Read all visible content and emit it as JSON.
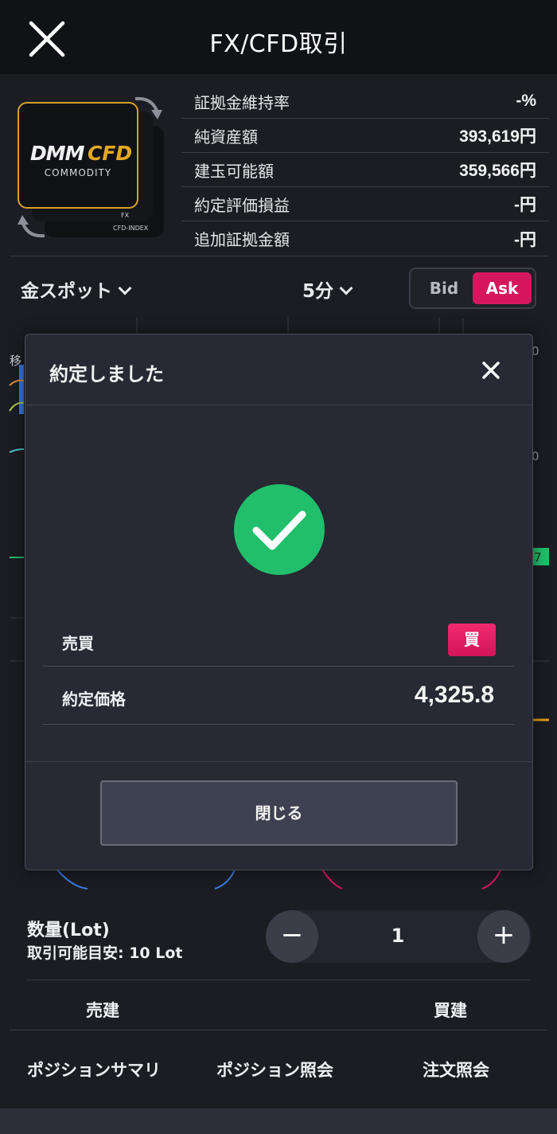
{
  "header": {
    "title": "FX/CFD取引"
  },
  "logo": {
    "brand_left": "DMM",
    "brand_right": "CFD",
    "subtitle": "COMMODITY",
    "tag_fx": "FX",
    "tag_index": "CFD-INDEX"
  },
  "account": {
    "rows": [
      {
        "label": "証拠金維持率",
        "value": "-%"
      },
      {
        "label": "純資産額",
        "value": "393,619円"
      },
      {
        "label": "建玉可能額",
        "value": "359,566円"
      },
      {
        "label": "約定評価損益",
        "value": "-円"
      },
      {
        "label": "追加証拠金額",
        "value": "-円"
      }
    ]
  },
  "toolbar": {
    "instrument": "金スポット",
    "timeframe": "5分",
    "bid_label": "Bid",
    "ask_label": "Ask"
  },
  "chart": {
    "partial_label": "移",
    "tick_1": "0",
    "tick_2": "0",
    "tick_3": "7"
  },
  "modal": {
    "title": "約定しました",
    "side_label": "売買",
    "side_value": "買",
    "price_label": "約定価格",
    "price_value": "4,325.8",
    "close_label": "閉じる"
  },
  "quantity": {
    "title": "数量(Lot)",
    "hint": "取引可能目安: 10 Lot",
    "value": "1",
    "minus": "−",
    "plus": "+"
  },
  "actions": {
    "sell": "売建",
    "buy": "買建"
  },
  "nav": {
    "items": [
      "ポジションサマリ",
      "ポジション照会",
      "注文照会"
    ]
  },
  "colors": {
    "accent": "#d6175e",
    "success": "#21bf6b",
    "brand_gold": "#d6a127"
  }
}
